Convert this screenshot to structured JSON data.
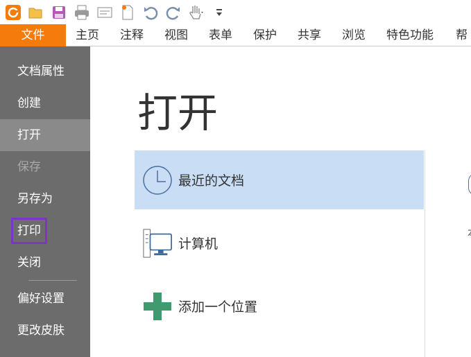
{
  "quick_access": [
    {
      "name": "app-logo-icon"
    },
    {
      "name": "open-folder-icon"
    },
    {
      "name": "save-icon"
    },
    {
      "name": "print-icon"
    },
    {
      "name": "scan-icon"
    },
    {
      "name": "new-doc-icon"
    },
    {
      "name": "undo-icon"
    },
    {
      "name": "redo-icon"
    },
    {
      "name": "hand-tool-icon"
    },
    {
      "name": "customize-toolbar-icon"
    }
  ],
  "tabs": [
    "文件",
    "主页",
    "注释",
    "视图",
    "表单",
    "保护",
    "共享",
    "浏览",
    "特色功能",
    "帮"
  ],
  "nav": {
    "items": [
      {
        "label": "文档属性",
        "state": "normal"
      },
      {
        "label": "创建",
        "state": "normal"
      },
      {
        "label": "打开",
        "state": "active"
      },
      {
        "label": "保存",
        "state": "disabled"
      },
      {
        "label": "另存为",
        "state": "normal"
      },
      {
        "label": "打印",
        "state": "highlighted"
      },
      {
        "label": "关闭",
        "state": "normal"
      },
      {
        "label": "偏好设置",
        "state": "normal"
      },
      {
        "label": "更改皮肤",
        "state": "normal"
      }
    ]
  },
  "main": {
    "title": "打开",
    "locations": [
      {
        "label": "最近的文档",
        "icon": "clock-icon",
        "selected": true
      },
      {
        "label": "计算机",
        "icon": "computer-icon",
        "selected": false
      },
      {
        "label": "添加一个位置",
        "icon": "add-location-icon",
        "selected": false
      }
    ],
    "peek_text": "本"
  },
  "colors": {
    "accent": "#f57c0a",
    "nav_bg": "#6c6c6c",
    "nav_active": "#8a8a8a",
    "highlight_box": "#7a36c4",
    "selected_row": "#c9ddf5"
  }
}
